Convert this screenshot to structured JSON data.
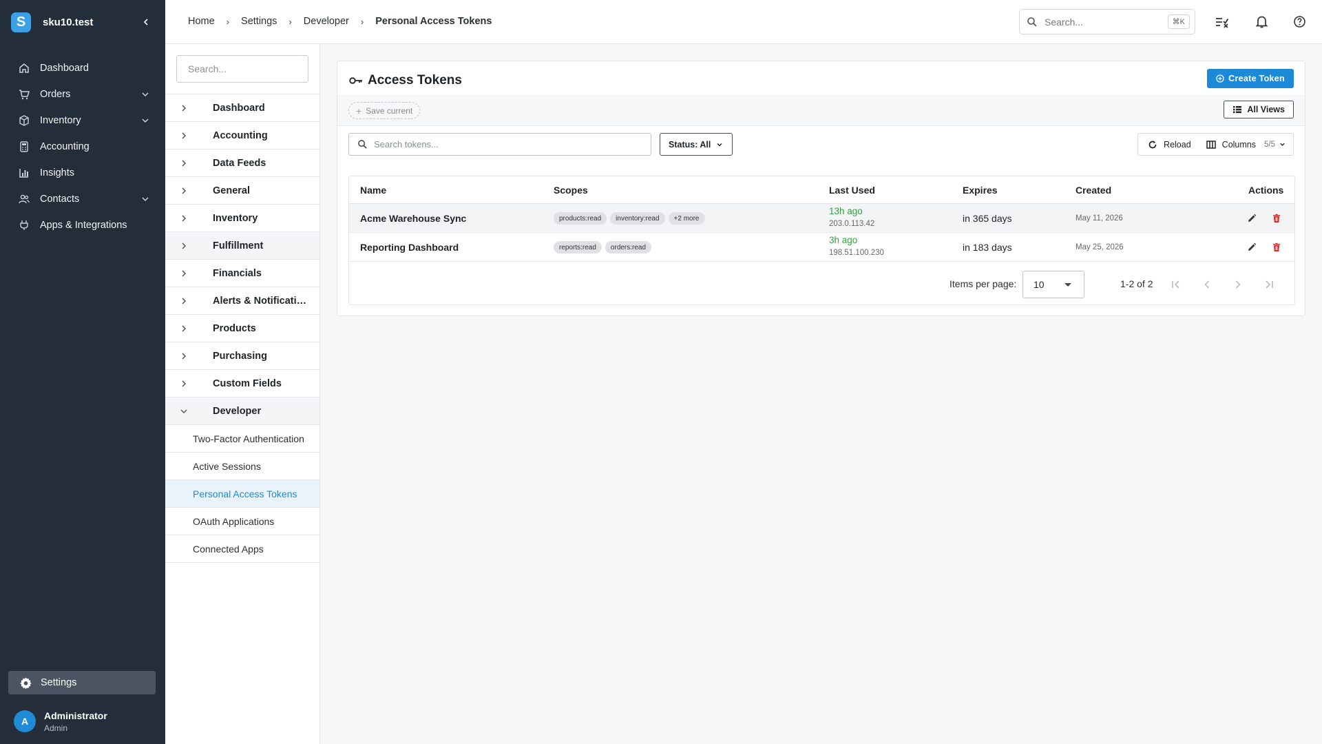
{
  "app": {
    "tenant": "sku10.test",
    "logo_letter": "S",
    "brand_color": "#3ba1e6"
  },
  "sidebar": {
    "items": [
      {
        "label": "Dashboard",
        "icon": "home-icon",
        "has_children": false
      },
      {
        "label": "Orders",
        "icon": "cart-icon",
        "has_children": true
      },
      {
        "label": "Inventory",
        "icon": "box-icon",
        "has_children": true
      },
      {
        "label": "Accounting",
        "icon": "calculator-icon",
        "has_children": false
      },
      {
        "label": "Insights",
        "icon": "bar-chart-icon",
        "has_children": false
      },
      {
        "label": "Contacts",
        "icon": "people-icon",
        "has_children": true
      },
      {
        "label": "Apps & Integrations",
        "icon": "plug-icon",
        "has_children": false
      }
    ],
    "settings_label": "Settings",
    "user": {
      "initial": "A",
      "name": "Administrator",
      "role": "Admin"
    }
  },
  "topbar": {
    "breadcrumbs": [
      "Home",
      "Settings",
      "Developer",
      "Personal Access Tokens"
    ],
    "search_placeholder": "Search...",
    "search_shortcut": "⌘K"
  },
  "settings_nav": {
    "search_placeholder": "Search...",
    "sections": [
      "Dashboard",
      "Accounting",
      "Data Feeds",
      "General",
      "Inventory",
      "Fulfillment",
      "Financials",
      "Alerts & Notifications",
      "Products",
      "Purchasing",
      "Custom Fields",
      "Developer"
    ],
    "developer_children": [
      "Two-Factor Authentication",
      "Active Sessions",
      "Personal Access Tokens",
      "OAuth Applications",
      "Connected Apps"
    ],
    "active_child": "Personal Access Tokens"
  },
  "main": {
    "title": "Access Tokens",
    "create_label": "Create Token",
    "save_current_label": "Save current",
    "all_views_label": "All Views",
    "search_placeholder": "Search tokens...",
    "status_filter": "Status: All",
    "reload_label": "Reload",
    "columns_label": "Columns",
    "columns_count": "5/5",
    "accent_color": "#1c8ad8"
  },
  "table": {
    "columns": [
      "Name",
      "Scopes",
      "Last Used",
      "Expires",
      "Created",
      "Actions"
    ],
    "rows": [
      {
        "name": "Acme Warehouse Sync",
        "scopes": [
          "products:read",
          "inventory:read",
          "+2 more"
        ],
        "last_used": "13h ago",
        "last_ip": "203.0.113.42",
        "expires": "in 365 days",
        "created": "May 11, 2026"
      },
      {
        "name": "Reporting Dashboard",
        "scopes": [
          "reports:read",
          "orders:read"
        ],
        "last_used": "3h ago",
        "last_ip": "198.51.100.230",
        "expires": "in 183 days",
        "created": "May 25, 2026"
      }
    ],
    "pagination": {
      "items_per_page_label": "Items per page:",
      "per_page": "10",
      "range": "1-2 of 2"
    }
  }
}
